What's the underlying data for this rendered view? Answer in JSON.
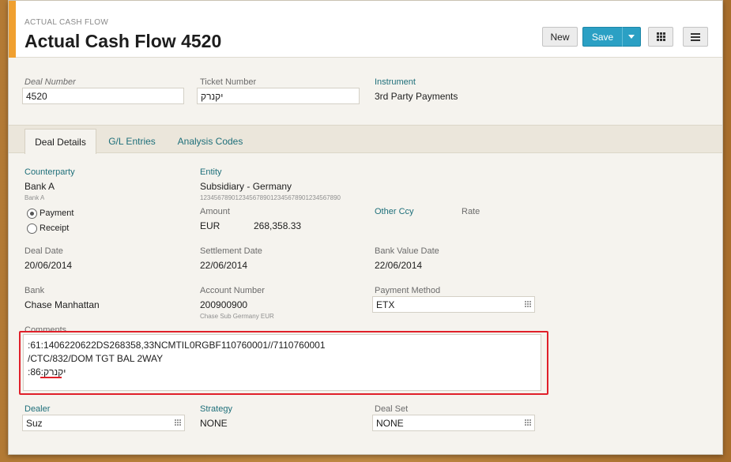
{
  "header": {
    "breadcrumb": "ACTUAL CASH FLOW",
    "title": "Actual Cash Flow 4520",
    "buttons": {
      "new": "New",
      "save": "Save"
    }
  },
  "top_fields": {
    "deal_number": {
      "label": "Deal Number",
      "value": "4520"
    },
    "ticket_number": {
      "label": "Ticket Number",
      "value": "יקנרק"
    },
    "instrument": {
      "label": "Instrument",
      "value": "3rd Party Payments"
    }
  },
  "tabs": [
    "Deal Details",
    "G/L Entries",
    "Analysis Codes"
  ],
  "details": {
    "counterparty": {
      "label": "Counterparty",
      "value": "Bank A",
      "sub": "Bank A"
    },
    "entity": {
      "label": "Entity",
      "value": "Subsidiary - Germany",
      "sub": "1234567890123456789012345678901234567890"
    },
    "direction": {
      "payment": "Payment",
      "receipt": "Receipt",
      "selected": "Payment"
    },
    "amount": {
      "label": "Amount",
      "currency": "EUR",
      "value": "268,358.33"
    },
    "other_ccy": {
      "label": "Other Ccy"
    },
    "rate": {
      "label": "Rate"
    },
    "deal_date": {
      "label": "Deal Date",
      "value": "20/06/2014"
    },
    "settlement_date": {
      "label": "Settlement Date",
      "value": "22/06/2014"
    },
    "bank_value_date": {
      "label": "Bank Value Date",
      "value": "22/06/2014"
    },
    "bank": {
      "label": "Bank",
      "value": "Chase Manhattan"
    },
    "account_number": {
      "label": "Account Number",
      "value": "200900900",
      "sub": "Chase Sub Germany EUR"
    },
    "payment_method": {
      "label": "Payment Method",
      "value": "ETX"
    },
    "comments": {
      "label": "Comments",
      "lines": [
        ":61:1406220622DS268358,33NCMTIL0RGBF110760001//7110760001",
        "/CTC/832/DOM TGT BAL 2WAY",
        ":86:יקנרק"
      ]
    },
    "dealer": {
      "label": "Dealer",
      "value": "Suz"
    },
    "strategy": {
      "label": "Strategy",
      "value": "NONE"
    },
    "deal_set": {
      "label": "Deal Set",
      "value": "NONE"
    }
  },
  "colors": {
    "accent": "#f0a030",
    "primary_button": "#2ba0c4",
    "link_label": "#1e6f7a",
    "highlight": "#e0202a"
  }
}
